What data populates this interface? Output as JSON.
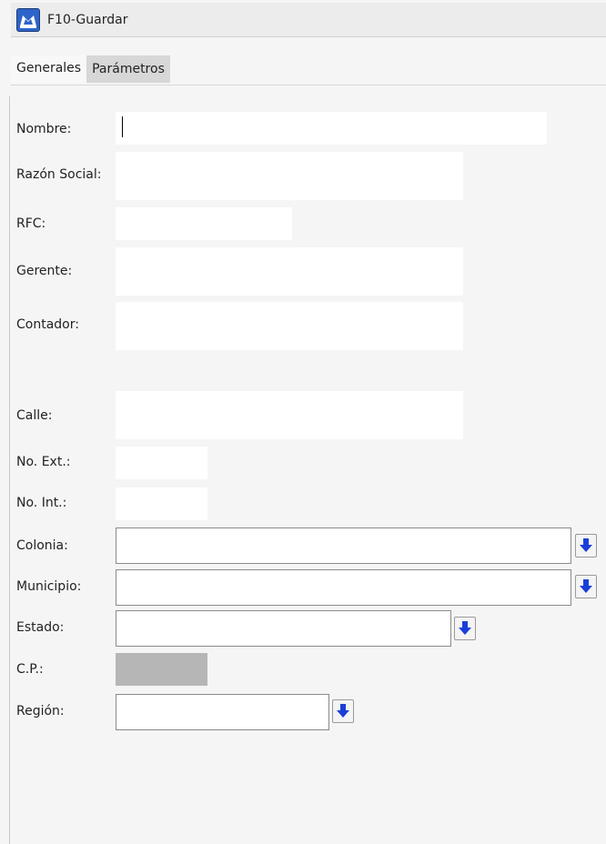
{
  "toolbar": {
    "save_label": "F10-Guardar",
    "save_icon": "company-building-icon"
  },
  "tabs": [
    {
      "label": "Generales",
      "active": true
    },
    {
      "label": "Parámetros",
      "active": false
    }
  ],
  "form": {
    "nombre_label": "Nombre:",
    "razon_social_label": "Razón Social:",
    "rfc_label": "RFC:",
    "gerente_label": "Gerente:",
    "contador_label": "Contador:",
    "calle_label": "Calle:",
    "no_ext_label": "No. Ext.:",
    "no_int_label": "No. Int.:",
    "colonia_label": "Colonia:",
    "municipio_label": "Municipio:",
    "estado_label": "Estado:",
    "cp_label": "C.P.:",
    "region_label": "Región:",
    "nombre_value": "",
    "razon_social_value": "",
    "rfc_value": "",
    "gerente_value": "",
    "contador_value": "",
    "calle_value": "",
    "no_ext_value": "",
    "no_int_value": "",
    "colonia_value": "",
    "municipio_value": "",
    "estado_value": "",
    "cp_value": "",
    "region_value": "",
    "dropdown_icon": "blue-down-arrow-icon"
  },
  "colors": {
    "dropdown_arrow": "#1a3fd8",
    "disabled_field": "#b6b6b6",
    "field_background": "#ffffff"
  }
}
